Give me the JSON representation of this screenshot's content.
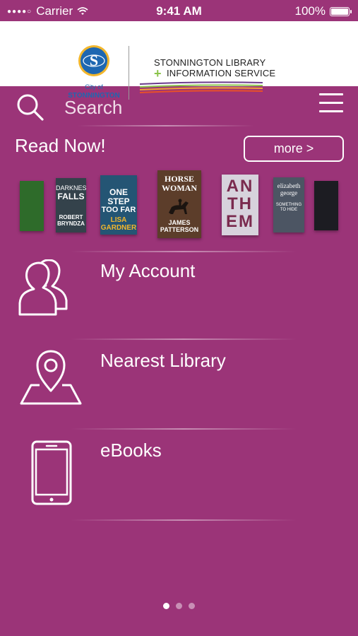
{
  "status_bar": {
    "carrier": "Carrier",
    "time": "9:41 AM",
    "battery": "100%",
    "battery_level": 1.0
  },
  "brand": {
    "city_small": "City of",
    "city_name": "STONNINGTON",
    "library_line1": "STONNINGTON LIBRARY",
    "library_line2": "INFORMATION SERVICE",
    "stripe_colors": [
      "#6a3b8c",
      "#8bc34a",
      "#f0a33a",
      "#e8502a"
    ],
    "seal_color": "#1e67b1",
    "seal_ring_color": "#f2b62c"
  },
  "search": {
    "label": "Search"
  },
  "read_now": {
    "heading": "Read Now!",
    "more_label": "more >"
  },
  "books": [
    {
      "lines": [
        ""
      ],
      "color": "#2e6b2a"
    },
    {
      "lines": [
        "DARKNESS",
        "FALLS",
        "ROBERT",
        "BRYNDZA"
      ],
      "color": "#34424b"
    },
    {
      "lines": [
        "ONE",
        "STEP",
        "TOO FAR",
        "LISA",
        "GARDNER"
      ],
      "color": "#245574"
    },
    {
      "lines": [
        "HORSE",
        "WOMAN",
        "JAMES",
        "PATTERSON"
      ],
      "color": "#5c3d2a"
    },
    {
      "lines": [
        "AN",
        "TH",
        "EM"
      ],
      "color": "#d7d2dc"
    },
    {
      "lines": [
        "elizabeth",
        "george",
        "SOMETHING",
        "TO HIDE"
      ],
      "color": "#4c5563"
    },
    {
      "lines": [
        ""
      ],
      "color": "#1c1c22"
    }
  ],
  "menu": [
    {
      "label": "My Account",
      "icon": "users-icon"
    },
    {
      "label": "Nearest Library",
      "icon": "map-pin-icon"
    },
    {
      "label": "eBooks",
      "icon": "phone-icon"
    }
  ],
  "pager": {
    "pages": 3,
    "current": 1
  },
  "colors": {
    "background": "#9b3478",
    "accent_white": "#ffffff"
  }
}
